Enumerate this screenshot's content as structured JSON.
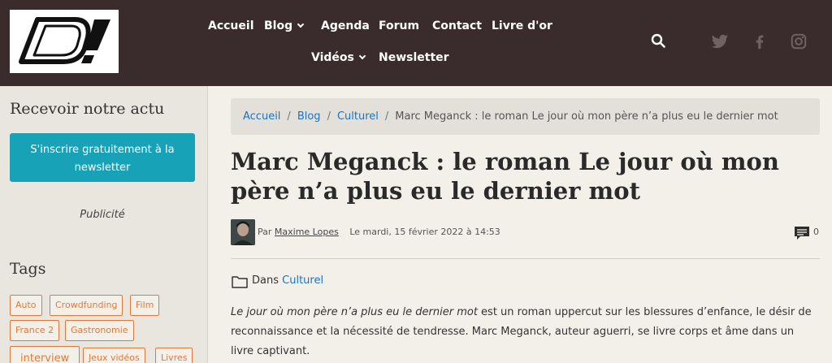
{
  "header": {
    "logo_text": "D!",
    "nav": [
      {
        "label": "Accueil"
      },
      {
        "label": "Blog",
        "has_dropdown": true
      },
      {
        "label": "Agenda"
      },
      {
        "label": "Forum"
      },
      {
        "label": "Contact"
      },
      {
        "label": "Livre d'or"
      },
      {
        "label": "Vidéos",
        "has_dropdown": true
      },
      {
        "label": "Newsletter"
      }
    ],
    "icons": [
      "search-icon",
      "twitter-icon",
      "facebook-icon",
      "instagram-icon"
    ]
  },
  "sidebar": {
    "newsletter_title": "Recevoir notre actu",
    "newsletter_button": "S'inscrire gratuitement à la newsletter",
    "pub_label": "Publicité",
    "tags_title": "Tags",
    "tags": [
      "Auto",
      "Crowdfunding",
      "Film",
      "France 2",
      "Gastronomie",
      "interview",
      "Jeux vidéos",
      "Livres"
    ]
  },
  "breadcrumb": {
    "items": [
      "Accueil",
      "Blog",
      "Culturel"
    ],
    "current": "Marc Meganck : le roman Le jour où mon père n’a plus eu le dernier mot"
  },
  "post": {
    "title": "Marc Meganck : le roman Le jour où mon père n’a plus eu le dernier mot",
    "by_label": "Par",
    "author": "Maxime Lopes",
    "date": "Le mardi, 15 février 2022 à 14:53",
    "comment_count": "0",
    "category_prefix": "Dans",
    "category": "Culturel",
    "intro_italic": "Le jour où mon père n’a plus eu le dernier mot",
    "intro_rest": " est un roman uppercut sur les blessures d’enfance, le désir de reconnaissance et la nécessité de tendresse. Marc Meganck, auteur aguerri, se livre corps et âme dans un livre captivant."
  },
  "colors": {
    "header_bg": "#3a2b2c",
    "accent_button": "#17a2b8",
    "link": "#1e73be",
    "tag": "#e07a3a"
  }
}
